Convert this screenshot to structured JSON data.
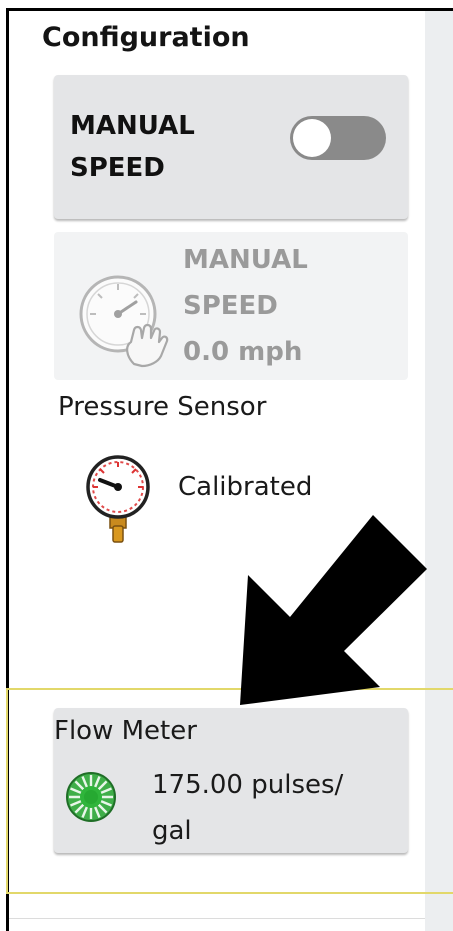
{
  "section_title": "Configuration",
  "manual_speed_card": {
    "label_line1": "MANUAL",
    "label_line2": "SPEED",
    "toggle_on": false
  },
  "manual_speed_status": {
    "line1": "MANUAL",
    "line2": "SPEED",
    "value": "0.0 mph",
    "icon": "speedometer-hand-icon"
  },
  "pressure_sensor": {
    "label": "Pressure Sensor",
    "status": "Calibrated",
    "icon": "pressure-gauge-icon"
  },
  "flow_meter": {
    "label": "Flow Meter",
    "value_line1": "175.00 pulses/",
    "value_line2": "gal",
    "icon": "flow-meter-icon"
  },
  "colors": {
    "card_bg": "#e4e5e7",
    "disabled_text": "#9a9a9a",
    "toggle_off": "#8a8a8a",
    "highlight_border": "#e2d86a",
    "flow_icon_green": "#3fae49"
  }
}
